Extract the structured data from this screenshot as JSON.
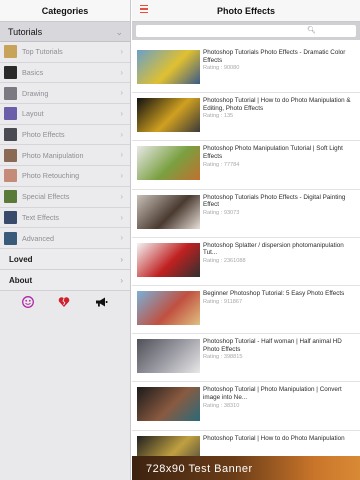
{
  "left_panel": {
    "title": "Categories",
    "section_title": "Tutorials",
    "items": [
      {
        "label": "Top Tutorials",
        "color": "#c8a35a"
      },
      {
        "label": "Basics",
        "color": "#2a2a2a"
      },
      {
        "label": "Drawing",
        "color": "#7a7a80"
      },
      {
        "label": "Layout",
        "color": "#6a5fa8"
      },
      {
        "label": "Photo Effects",
        "color": "#4a4a52"
      },
      {
        "label": "Photo Manipulation",
        "color": "#8a6a55"
      },
      {
        "label": "Photo Retouching",
        "color": "#c48b78"
      },
      {
        "label": "Special Effects",
        "color": "#5a7a3a"
      },
      {
        "label": "Text Effects",
        "color": "#3a4a6a"
      },
      {
        "label": "Advanced",
        "color": "#3a5a7a"
      }
    ],
    "loved_label": "Loved",
    "about_label": "About",
    "bottom_icons": [
      "smiley-icon",
      "broken-heart-icon",
      "megaphone-icon"
    ]
  },
  "right_panel": {
    "title": "Photo Effects",
    "search_placeholder": "",
    "videos": [
      {
        "title": "Photoshop Tutorials Photo Effects - Dramatic Color Effects",
        "rating": "Rating : 90080",
        "thumb": [
          "#6aa0c8",
          "#e0c030",
          "#3a5a8a"
        ]
      },
      {
        "title": "Photoshop Tutorial | How to do Photo Manipulation & Editing, Photo Effects",
        "rating": "Rating : 135",
        "thumb": [
          "#111111",
          "#d0a020",
          "#3a3a3a"
        ]
      },
      {
        "title": "Photoshop Photo Manipulation Tutorial | Soft Light Effects",
        "rating": "Rating : 77784",
        "thumb": [
          "#e8e8e8",
          "#7aa040",
          "#c07030"
        ]
      },
      {
        "title": "Photoshop Tutorials Photo Effects - Digital Painting Effect",
        "rating": "Rating : 93073",
        "thumb": [
          "#c8c0b8",
          "#4a3a30",
          "#e8e0d8"
        ]
      },
      {
        "title": "Photoshop Splatter / dispersion photomanipulation Tut...",
        "rating": "Rating : 2361088",
        "thumb": [
          "#f4f4f4",
          "#c02020",
          "#303030"
        ]
      },
      {
        "title": "Beginner Photoshop Tutorial: 5 Easy Photo Effects",
        "rating": "Rating : 911867",
        "thumb": [
          "#7ab0d8",
          "#c05040",
          "#e0c080"
        ]
      },
      {
        "title": "Photoshop Tutorial - Half woman | Half animal HD Photo Effects",
        "rating": "Rating : 398815",
        "thumb": [
          "#505058",
          "#a0a0a8",
          "#e8e8e8"
        ]
      },
      {
        "title": "Photoshop Tutorial | Photo Manipulation | Convert image into Ne...",
        "rating": "Rating : 38310",
        "thumb": [
          "#1a1a1a",
          "#8a5a40",
          "#2a6a7a"
        ]
      },
      {
        "title": "Photoshop Tutorial | How to do Photo Manipulation",
        "rating": "",
        "thumb": [
          "#202020",
          "#c0a040",
          "#404040"
        ]
      }
    ],
    "banner_text": "728x90  Test Banner"
  },
  "colors": {
    "accent": "#e84d3d",
    "smiley": "#b02aa8",
    "heart": "#d0202a"
  }
}
